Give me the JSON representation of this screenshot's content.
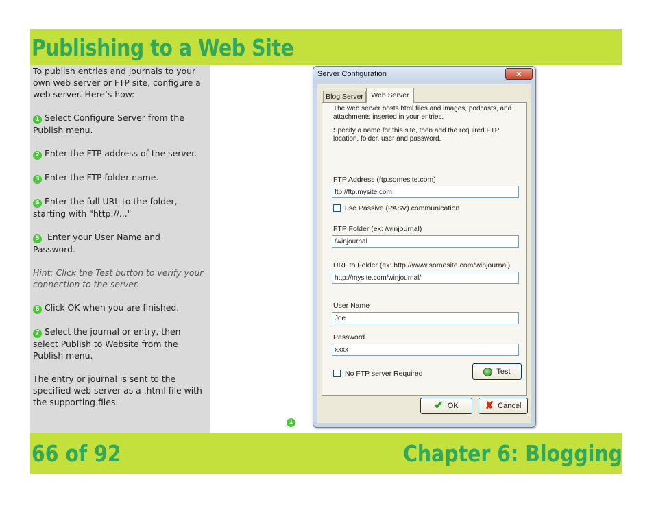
{
  "header": {
    "title": "Publishing to a Web Site"
  },
  "instructions": {
    "intro": "To publish entries and journals to your own web server or FTP site, configure a web server. Here’s how:",
    "steps": [
      {
        "num": "1",
        "text": "Select Configure Server from the Publish menu."
      },
      {
        "num": "2",
        "text": "Enter the FTP address of the server."
      },
      {
        "num": "3",
        "text": "Enter the FTP folder name."
      },
      {
        "num": "4",
        "text": "Enter the full URL to the folder, starting with \"http://...\""
      },
      {
        "num": "5",
        "text": " Enter your User Name and Password."
      }
    ],
    "hint": "Hint: Click the Test button to verify your connection to the server.",
    "steps2": [
      {
        "num": "6",
        "text": "Click OK when you are finished."
      },
      {
        "num": "7",
        "text": "Select the journal or entry, then select Publish to Website from the Publish menu."
      }
    ],
    "outro": "The entry or journal is sent to the specified web server as a .html file with the supporting files."
  },
  "callout": {
    "num": "1"
  },
  "dialog": {
    "title": "Server Configuration",
    "close": "x",
    "tabs": [
      {
        "label": "Blog Server"
      },
      {
        "label": "Web Server"
      }
    ],
    "desc1": "The web server hosts html files and images, podcasts, and attachments inserted in your entries.",
    "desc2": "Specify a name for this site, then add the required FTP location, folder, user and password.",
    "ftp_address_label": "FTP Address (ftp.somesite.com)",
    "ftp_address_value": "ftp://ftp.mysite.com",
    "passive_label": "use Passive (PASV) communication",
    "ftp_folder_label": "FTP Folder (ex: /winjournal)",
    "ftp_folder_value": "/winjournal",
    "url_label": "URL to Folder (ex: http://www.somesite.com/winjournal)",
    "url_value": "http://mysite.com/winjournal/",
    "user_label": "User Name",
    "user_value": "Joe",
    "password_label": "Password",
    "password_value": "xxxx",
    "no_ftp_label": "No FTP server Required",
    "test_label": "Test",
    "ok_label": "OK",
    "cancel_label": "Cancel"
  },
  "footer": {
    "page": "66 of 92",
    "chapter": "Chapter 6: Blogging"
  },
  "colors": {
    "bar": "#c3e03c",
    "heading": "#33a85a",
    "panel": "#dadada",
    "step_badge": "#4cc43c"
  }
}
